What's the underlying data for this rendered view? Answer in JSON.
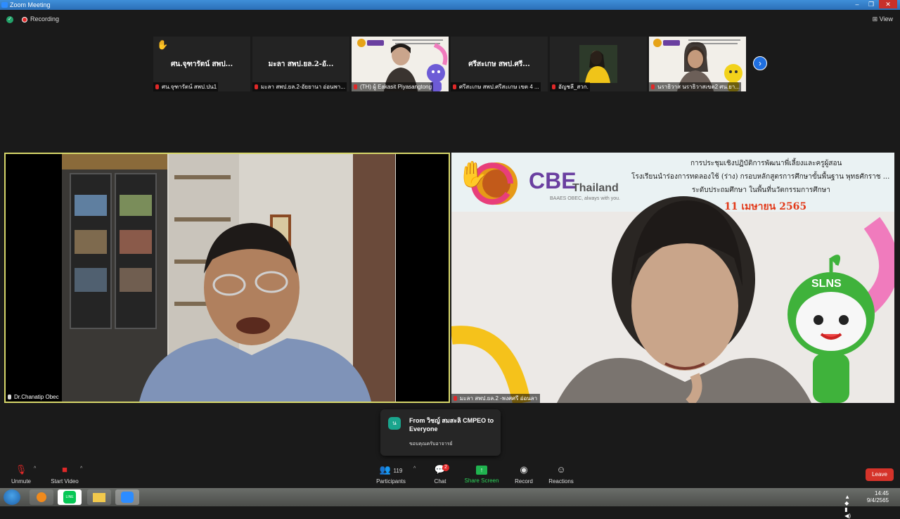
{
  "window": {
    "title": "Zoom Meeting",
    "controls": [
      "–",
      "❐",
      "✕"
    ]
  },
  "topbar": {
    "recording_label": "Recording",
    "view_label": "View"
  },
  "thumbnails": [
    {
      "big_name": "ศน.จุฑารัตน์ สพป...",
      "caption": "ศน.จุฑารัตน์ สพป.ปน1",
      "hand": true,
      "video": false
    },
    {
      "big_name": "มะลา สพป.ยล.2-อั...",
      "caption": "มะลา สพป.ยล.2-อัยยานา อ่อนพา...",
      "hand": false,
      "video": false
    },
    {
      "big_name": "",
      "caption": "(TH) ผู้ Eakasit Piyasangtong",
      "hand": false,
      "video": true
    },
    {
      "big_name": "ศรีสะเกษ สพป.ศรี...",
      "caption": "ศรีสะเกษ สพป.ศรีสะเกษ เขต 4 ...",
      "hand": false,
      "video": false
    },
    {
      "big_name": "",
      "caption": "อัญชลี_สวก.",
      "hand": false,
      "video": true
    },
    {
      "big_name": "",
      "caption": "นราธิวาส นราธิวาสเขต2 ศน.ยา...",
      "hand": false,
      "video": true
    }
  ],
  "speakers": {
    "left_name": "Dr.Chanatip Obec",
    "right_name": "มะลา สพป.ยล.2 -พงศศรี อ่อนลา",
    "slide_title_1": "การประชุมเชิงปฏิบัติการพัฒนาพี่เลี้ยงและครูผู้สอน",
    "slide_title_2": "โรงเรียนนำร่องการทดลองใช้ (ร่าง) กรอบหลักสูตรการศึกษาขั้นพื้นฐาน พุทธศักราช ...",
    "slide_title_3": "ระดับประถมศึกษา ในพื้นที่นวัตกรรมการศึกษา",
    "slide_date": "11 เมษายน 2565",
    "brand_main": "CBE",
    "brand_sub": "Thailand",
    "brand_tag": "BAAES OBEC, always with you.",
    "mascot_label": "SLNS"
  },
  "chat_popup": {
    "from": "From วิชญ์ สมสะลิ CMPEO to Everyone",
    "message": "ขอบคุณครับอาจารย์",
    "icon_text": "น"
  },
  "toolbar": {
    "unmute": "Unmute",
    "start_video": "Start Video",
    "participants": "Participants",
    "participants_count": "119",
    "chat": "Chat",
    "chat_badge": "2",
    "share_screen": "Share Screen",
    "record": "Record",
    "reactions": "Reactions",
    "leave": "Leave"
  },
  "taskbar": {
    "time": "14:45",
    "date": "9/4/2565",
    "line_app": "LINE"
  },
  "colors": {
    "accent_blue": "#1f6fe0",
    "share_green": "#20b34f",
    "leave_red": "#d5332a",
    "active_border": "#d7d76a"
  }
}
